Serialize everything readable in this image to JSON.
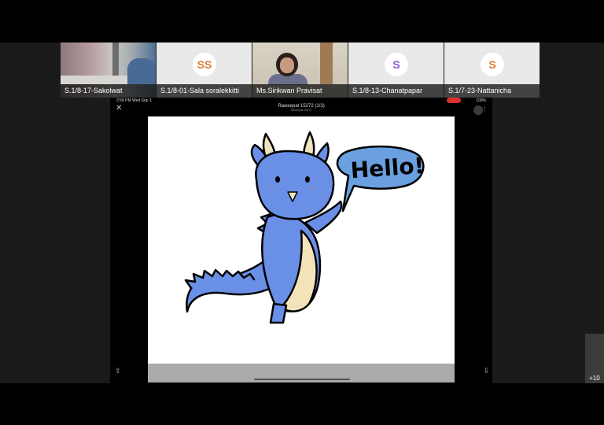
{
  "participants": [
    {
      "name": "S.1/8-17-Sakolwat",
      "type": "video"
    },
    {
      "name": "S.1/8-01-Sala soralekkitti",
      "type": "avatar",
      "initials": "SS",
      "initials_color": "#e07b39"
    },
    {
      "name": "Ms.Sirikwan Pravisat",
      "type": "video"
    },
    {
      "name": "S.1/8-13-Chanatpapar",
      "type": "avatar",
      "initials": "S",
      "initials_color": "#8a5cc7"
    },
    {
      "name": "S.1/7-23-Nattanicha",
      "type": "avatar",
      "initials": "S",
      "initials_color": "#e07b39"
    }
  ],
  "shared_screen": {
    "time": "2:58 PM  Wed Sep 1",
    "battery": "100%",
    "doc_title": "Raweepat 15272 (1/3)",
    "doc_subtitle": "Raweepat 15272",
    "speech_text": "Hello!",
    "colors": {
      "dragon": "#6a8fe6",
      "belly": "#f3e3b8",
      "horn": "#efe4c0"
    }
  },
  "more_participants_label": "+10"
}
